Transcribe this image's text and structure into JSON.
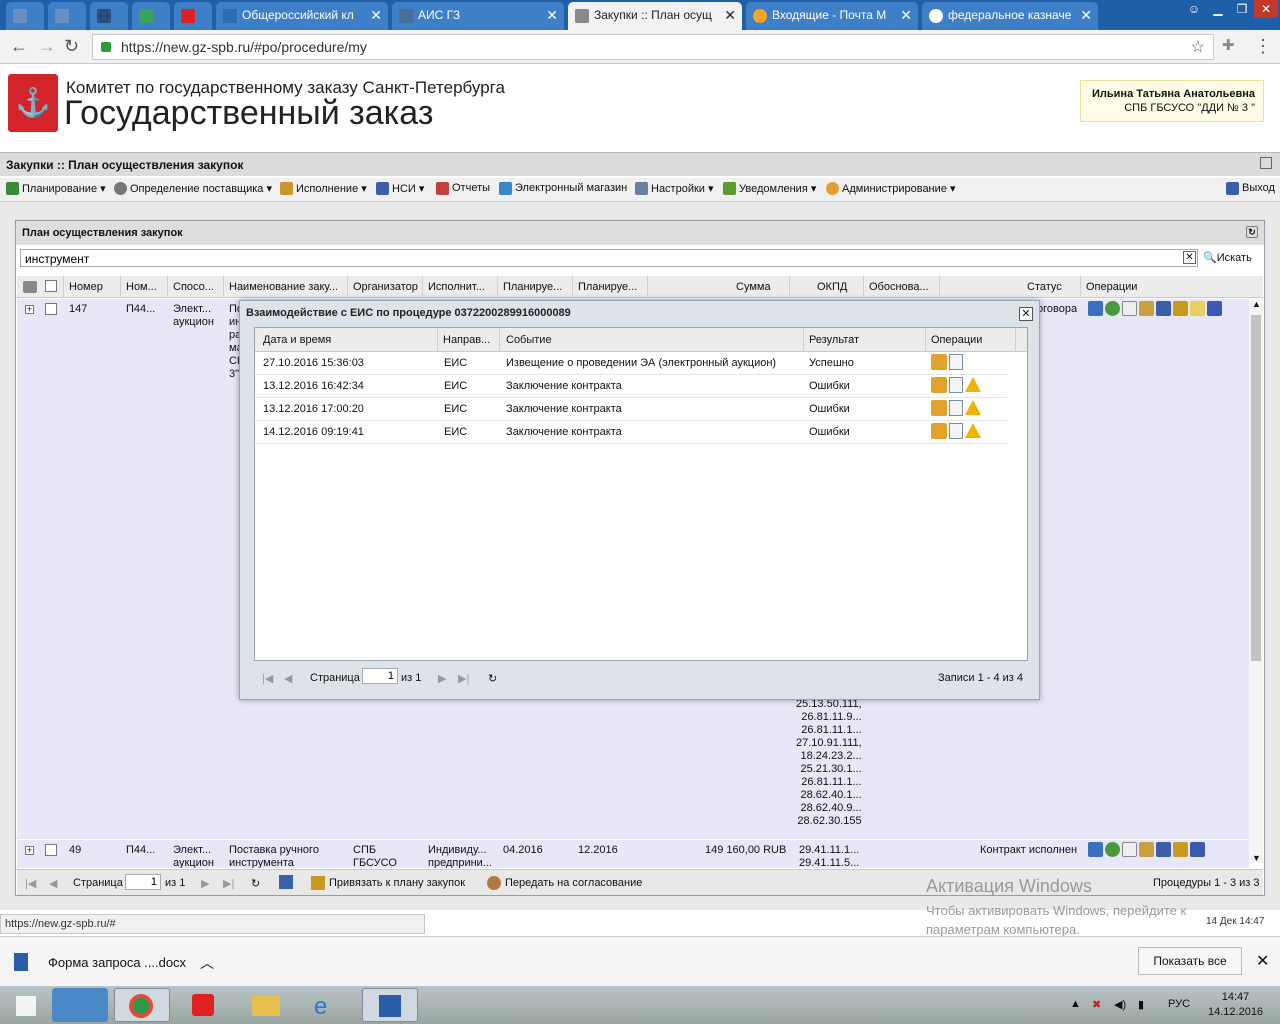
{
  "browser": {
    "tabs": [
      {
        "label": "",
        "active": false
      },
      {
        "label": "",
        "active": false
      },
      {
        "label": "",
        "active": false
      },
      {
        "label": "",
        "active": false
      },
      {
        "label": "",
        "active": false
      },
      {
        "label": "Общероссийский кл",
        "active": false
      },
      {
        "label": "АИС ГЗ",
        "active": false
      },
      {
        "label": "Закупки :: План осущ",
        "active": true
      },
      {
        "label": "Входящие - Почта М",
        "active": false
      },
      {
        "label": "федеральное казначе",
        "active": false
      }
    ],
    "url": "https://new.gz-spb.ru/#po/procedure/my"
  },
  "site": {
    "org_name": "Комитет по государственному заказу Санкт-Петербурга",
    "system_name": "Государственный заказ",
    "user_name": "Ильина Татьяна Анатольевна",
    "user_org": "СПБ ГБСУСО \"ДДИ № 3 \""
  },
  "app_title": "Закупки :: План осуществления закупок",
  "menu": {
    "planning": "Планирование",
    "supplier": "Определение поставщика",
    "execution": "Исполнение",
    "nsi": "НСИ",
    "reports": "Отчеты",
    "eshop": "Электронный магазин",
    "settings": "Настройки",
    "notifications": "Уведомления",
    "admin": "Администрирование",
    "exit": "Выход"
  },
  "panel": {
    "title": "План осуществления закупок",
    "search_value": "инструмент",
    "search_button": "Искать",
    "columns": [
      "Номер",
      "Ном...",
      "Спосо...",
      "Наименование заку...",
      "Организатор",
      "Исполнит...",
      "Планируе...",
      "Планируе...",
      "Сумма",
      "ОКПД",
      "Обоснова...",
      "Статус",
      "Операции"
    ],
    "row1": {
      "number": "147",
      "num2": "П44...",
      "method": "Элект...\nаукцион",
      "name_partial": "По\nин\nра\nма\nСП\n3\"",
      "status_partial": "оговора",
      "okpd_tail": "25.13.50.111,\n26.81.11.9...\n26.81.11.1...\n27.10.91.111,\n18.24.23.2...\n25.21.30.1...\n26.81.11.1...\n28.62.40.1...\n28.62.40.9...\n28.62.30.155"
    },
    "row2": {
      "number": "49",
      "num2": "П44...",
      "method": "Элект...\nаукцион",
      "name": "Поставка ручного\nинструмента",
      "organizer": "СПБ\nГБСУСО",
      "executor": "Индивиду...\nпредприни...",
      "plan_start": "04.2016",
      "plan_end": "12.2016",
      "sum": "149 160,00 RUB",
      "okpd": "29.41.11.1...\n29.41.11.5...",
      "status": "Контракт исполнен"
    },
    "footer": {
      "page_label": "Страница",
      "page_value": "1",
      "page_of": "из 1",
      "bind_plan": "Привязать к плану закупок",
      "send_approval": "Передать на согласование",
      "records": "Процедуры 1 - 3 из 3"
    }
  },
  "modal": {
    "title": "Взаимодействие с ЕИС по процедуре 0372200289916000089",
    "columns": {
      "datetime": "Дата и время",
      "direction": "Направ...",
      "event": "Событие",
      "result": "Результат",
      "operations": "Операции"
    },
    "rows": [
      {
        "datetime": "27.10.2016 15:36:03",
        "direction": "ЕИС",
        "event": "Извещение о проведении ЭА (электронный аукцион)",
        "result": "Успешно",
        "warning": false
      },
      {
        "datetime": "13.12.2016 16:42:34",
        "direction": "ЕИС",
        "event": "Заключение контракта",
        "result": "Ошибки",
        "warning": true
      },
      {
        "datetime": "13.12.2016 17:00:20",
        "direction": "ЕИС",
        "event": "Заключение контракта",
        "result": "Ошибки",
        "warning": true
      },
      {
        "datetime": "14.12.2016 09:19:41",
        "direction": "ЕИС",
        "event": "Заключение контракта",
        "result": "Ошибки",
        "warning": true
      }
    ],
    "pager": {
      "page_label": "Страница",
      "page_value": "1",
      "page_of": "из 1",
      "records": "Записи 1 - 4 из 4"
    }
  },
  "windows": {
    "activation_title": "Активация Windows",
    "activation_text": "Чтобы активировать Windows, перейдите к\nпараметрам компьютера.",
    "status_url": "https://new.gz-spb.ru/#",
    "status_datetime": "14 Дек 14:47",
    "download_file": "Форма запроса ....docx",
    "show_all": "Показать все",
    "lang": "РУС",
    "time": "14:47",
    "date": "14.12.2016"
  },
  "colors": {
    "row_selected": "#e7e7f8",
    "modal_bg": "#dee3ea",
    "tabbar": "#1f5fa8",
    "warning": "#f0b400"
  }
}
